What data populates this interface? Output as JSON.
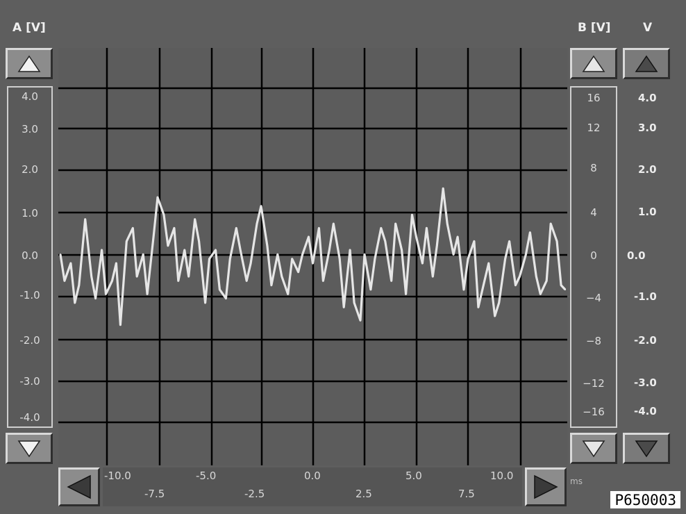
{
  "channel_a": {
    "label": "A [V]",
    "ticks": [
      "4.0",
      "3.0",
      "2.0",
      "1.0",
      "0.0",
      "-1.0",
      "-2.0",
      "-3.0",
      "-4.0"
    ]
  },
  "channel_b": {
    "label": "B [V]",
    "ticks": [
      "16",
      "12",
      "8",
      "4",
      "0",
      "−4",
      "−8",
      "−12",
      "−16"
    ]
  },
  "channel_v": {
    "label": "V",
    "ticks": [
      "4.0",
      "3.0",
      "2.0",
      "1.0",
      "0.0",
      "-1.0",
      "-2.0",
      "-3.0",
      "-4.0"
    ]
  },
  "time_axis": {
    "unit": "ms",
    "ticks_top": [
      "-10.0",
      "-5.0",
      "0.0",
      "5.0",
      "10.0"
    ],
    "ticks_bottom": [
      "-7.5",
      "-2.5",
      "2.5",
      "7.5"
    ]
  },
  "image_id_tag": "P650003",
  "colors": {
    "background": "#5e5e5e",
    "plot_background": "#5c5c5c",
    "grid": "#000000",
    "trace": "#e6e6e6"
  },
  "icons": {
    "up": "triangle-up-icon",
    "down": "triangle-down-icon",
    "left": "triangle-left-icon",
    "right": "triangle-right-icon"
  },
  "chart_data": {
    "type": "line",
    "title": "",
    "xlabel": "ms",
    "ylabel": "A [V]",
    "xlim": [
      -12.3,
      12.3
    ],
    "ylim": [
      -4.5,
      5.0
    ],
    "grid": true,
    "series": [
      {
        "x": [
          -12.2,
          -12.0,
          -11.7,
          -11.5,
          -11.3,
          -11.0,
          -10.7,
          -10.5,
          -10.2,
          -10.0,
          -9.7,
          -9.5,
          -9.3,
          -9.0,
          -8.7,
          -8.5,
          -8.2,
          -8.0,
          -7.7,
          -7.5,
          -7.2,
          -7.0,
          -6.7,
          -6.5,
          -6.2,
          -6.0,
          -5.7,
          -5.5,
          -5.2,
          -5.0,
          -4.7,
          -4.5,
          -4.2,
          -4.0,
          -3.7,
          -3.5,
          -3.2,
          -3.0,
          -2.7,
          -2.5,
          -2.2,
          -2.0,
          -1.7,
          -1.5,
          -1.2,
          -1.0,
          -0.7,
          -0.5,
          -0.2,
          0.0,
          0.3,
          0.5,
          0.8,
          1.0,
          1.3,
          1.5,
          1.8,
          2.0,
          2.3,
          2.5,
          2.8,
          3.0,
          3.3,
          3.5,
          3.8,
          4.0,
          4.3,
          4.5,
          4.8,
          5.0,
          5.3,
          5.5,
          5.8,
          6.0,
          6.3,
          6.5,
          6.8,
          7.0,
          7.3,
          7.5,
          7.8,
          8.0,
          8.3,
          8.5,
          8.8,
          9.0,
          9.3,
          9.5,
          9.8,
          10.0,
          10.3,
          10.5,
          10.8,
          11.0,
          11.3,
          11.5,
          11.8,
          12.0,
          12.2
        ],
        "y": [
          0.3,
          -0.3,
          0.1,
          -0.8,
          -0.4,
          1.1,
          -0.2,
          -0.7,
          0.4,
          -0.6,
          -0.3,
          0.1,
          -1.3,
          0.6,
          0.9,
          -0.2,
          0.3,
          -0.6,
          0.7,
          1.6,
          1.2,
          0.5,
          0.9,
          -0.3,
          0.4,
          -0.2,
          1.1,
          0.6,
          -0.8,
          0.2,
          0.4,
          -0.5,
          -0.7,
          0.2,
          0.9,
          0.4,
          -0.3,
          0.1,
          1.0,
          1.4,
          0.5,
          -0.4,
          0.3,
          -0.2,
          -0.6,
          0.2,
          -0.1,
          0.3,
          0.7,
          0.1,
          0.9,
          -0.3,
          0.4,
          1.0,
          0.2,
          -0.9,
          0.4,
          -0.8,
          -1.2,
          0.3,
          -0.5,
          0.2,
          0.9,
          0.6,
          -0.3,
          1.0,
          0.4,
          -0.6,
          1.2,
          0.7,
          0.1,
          0.9,
          -0.2,
          0.5,
          1.8,
          1.0,
          0.3,
          0.7,
          -0.5,
          0.2,
          0.6,
          -0.9,
          -0.3,
          0.1,
          -1.1,
          -0.8,
          0.2,
          0.6,
          -0.4,
          -0.2,
          0.3,
          0.8,
          -0.2,
          -0.6,
          -0.3,
          1.0,
          0.6,
          -0.4,
          -0.5
        ]
      }
    ]
  }
}
